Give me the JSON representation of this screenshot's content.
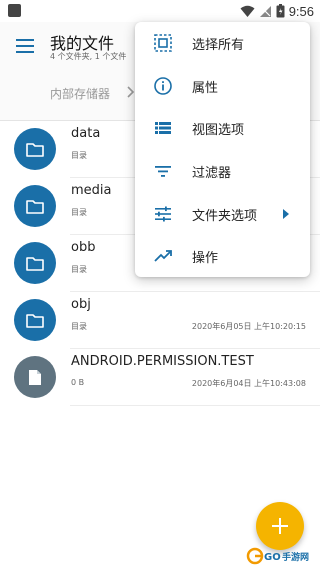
{
  "status_bar": {
    "time": "9:56"
  },
  "header": {
    "title": "我的文件",
    "subtitle": "4 个文件夹, 1 个文件"
  },
  "breadcrumb": {
    "current": "内部存储器"
  },
  "files": [
    {
      "name": "data",
      "type": "目录",
      "date": "",
      "kind": "folder"
    },
    {
      "name": "media",
      "type": "目录",
      "date": "",
      "kind": "folder"
    },
    {
      "name": "obb",
      "type": "目录",
      "date": "",
      "kind": "folder"
    },
    {
      "name": "obj",
      "type": "目录",
      "date": "2020年6月05日 上午10:20:15",
      "kind": "folder"
    },
    {
      "name": "ANDROID.PERMISSION.TEST",
      "type": "0 B",
      "date": "2020年6月04日 上午10:43:08",
      "kind": "file"
    }
  ],
  "menu": {
    "items": [
      {
        "label": "选择所有",
        "icon": "select-all-icon"
      },
      {
        "label": "属性",
        "icon": "info-icon"
      },
      {
        "label": "视图选项",
        "icon": "view-list-icon"
      },
      {
        "label": "过滤器",
        "icon": "filter-icon"
      },
      {
        "label": "文件夹选项",
        "icon": "tune-icon"
      },
      {
        "label": "操作",
        "icon": "trending-up-icon"
      }
    ]
  },
  "watermark": {
    "text": "GO手游网"
  },
  "colors": {
    "accent": "#1a6fa8",
    "folder": "#1a6fa8",
    "file": "#5f7380",
    "fab": "#f5b400"
  }
}
